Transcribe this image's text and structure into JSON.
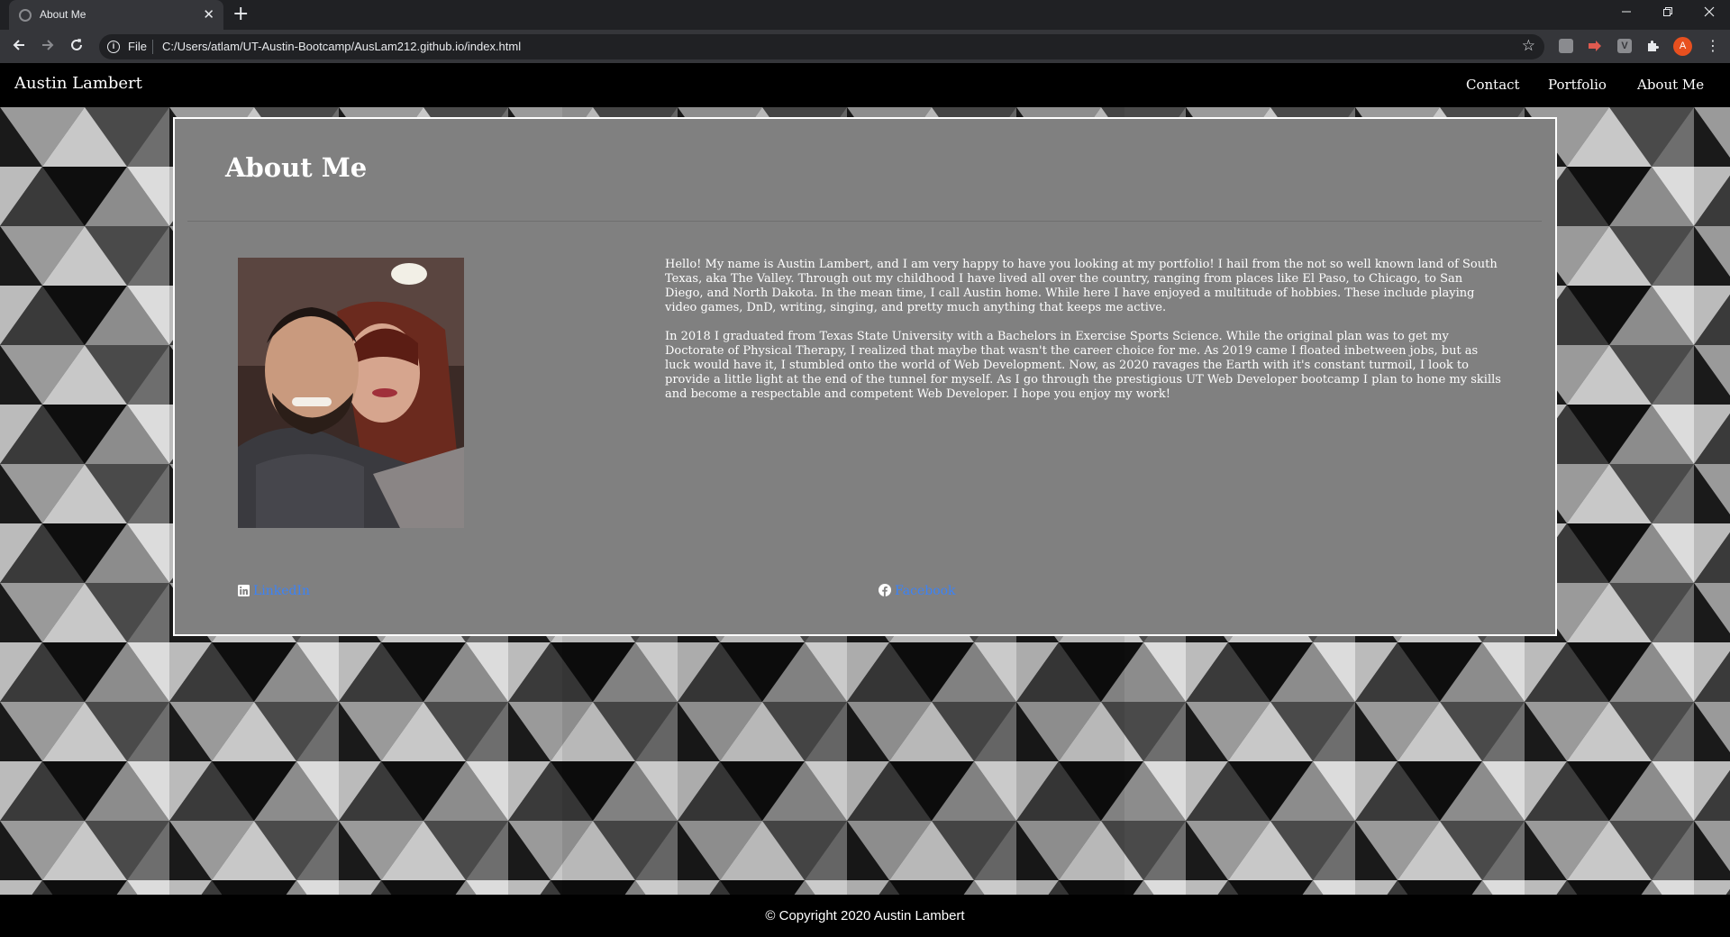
{
  "browser": {
    "tab_title": "About Me",
    "tab_close": "✕",
    "new_tab": "+",
    "scheme_label": "File",
    "url": "C:/Users/atlam/UT-Austin-Bootcamp/AusLam212.github.io/index.html",
    "profile_initial": "A",
    "accent": "#e8501f"
  },
  "nav": {
    "brand": "Austin Lambert",
    "links": [
      "Contact",
      "Portfolio",
      "About Me"
    ]
  },
  "about": {
    "title": "About Me",
    "paragraphs": [
      "Hello! My name is Austin Lambert, and I am very happy to have you looking at my portfolio! I hail from the not so well known land of South Texas, aka The Valley. Through out my childhood I have lived all over the country, ranging from places like El Paso, to Chicago, to San Diego, and North Dakota. In the mean time, I call Austin home. While here I have enjoyed a multitude of hobbies. These include playing video games, DnD, writing, singing, and pretty much anything that keeps me active.",
      "In 2018 I graduated from Texas State University with a Bachelors in Exercise Sports Science. While the original plan was to get my Doctorate of Physical Therapy, I realized that maybe that wasn't the career choice for me. As 2019 came I floated inbetween jobs, but as luck would have it, I stumbled onto the world of Web Development. Now, as 2020 ravages the Earth with it's constant turmoil, I look to provide a little light at the end of the tunnel for myself. As I go through the prestigious UT Web Developer bootcamp I plan to hone my skills and become a respectable and competent Web Developer. I hope you enjoy my work!"
    ],
    "links": {
      "linkedin": "LinkedIn",
      "facebook": "Facebook"
    },
    "link_color": "#3b82f6"
  },
  "footer": {
    "copyright": "© Copyright 2020 Austin Lambert"
  }
}
